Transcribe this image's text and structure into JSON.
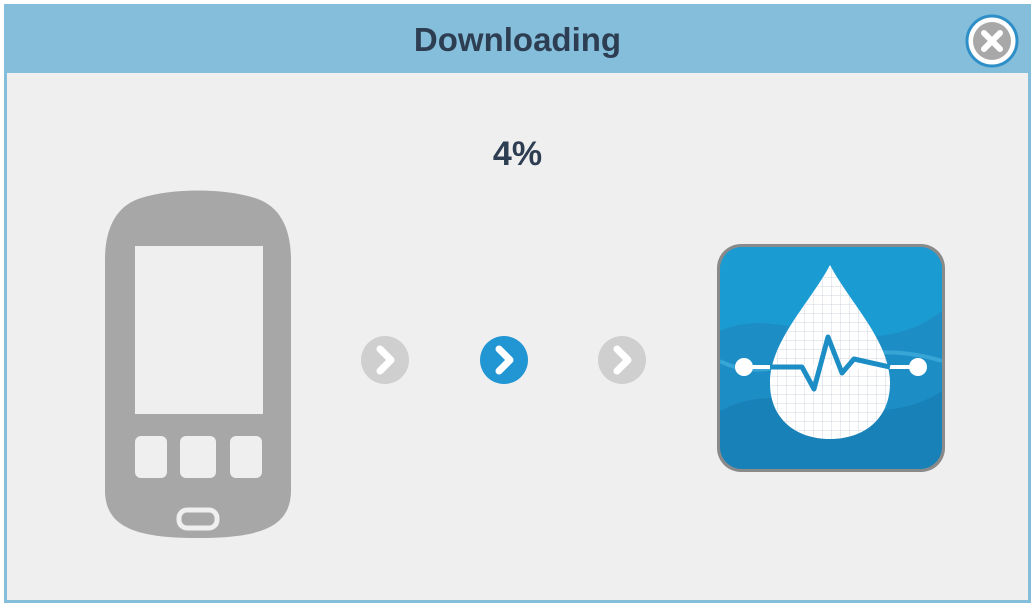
{
  "dialog": {
    "title": "Downloading",
    "close_icon": "close-circle-icon",
    "progress": {
      "percent_label": "4%",
      "value_percent": 4
    },
    "source_icon": "glucose-meter-icon",
    "target_icon": "drop-heartbeat-app-icon",
    "steps": [
      {
        "icon": "chevron-right-circle-icon",
        "state": "inactive"
      },
      {
        "icon": "chevron-right-circle-icon",
        "state": "active"
      },
      {
        "icon": "chevron-right-circle-icon",
        "state": "inactive"
      }
    ]
  },
  "colors": {
    "titlebar": "#85bedb",
    "body": "#efefef",
    "text": "#2e3e52",
    "meter": "#a7a7a7",
    "step_inactive": "#cfcfcf",
    "step_active": "#2196d3",
    "app_blue": "#1d8ec5"
  }
}
